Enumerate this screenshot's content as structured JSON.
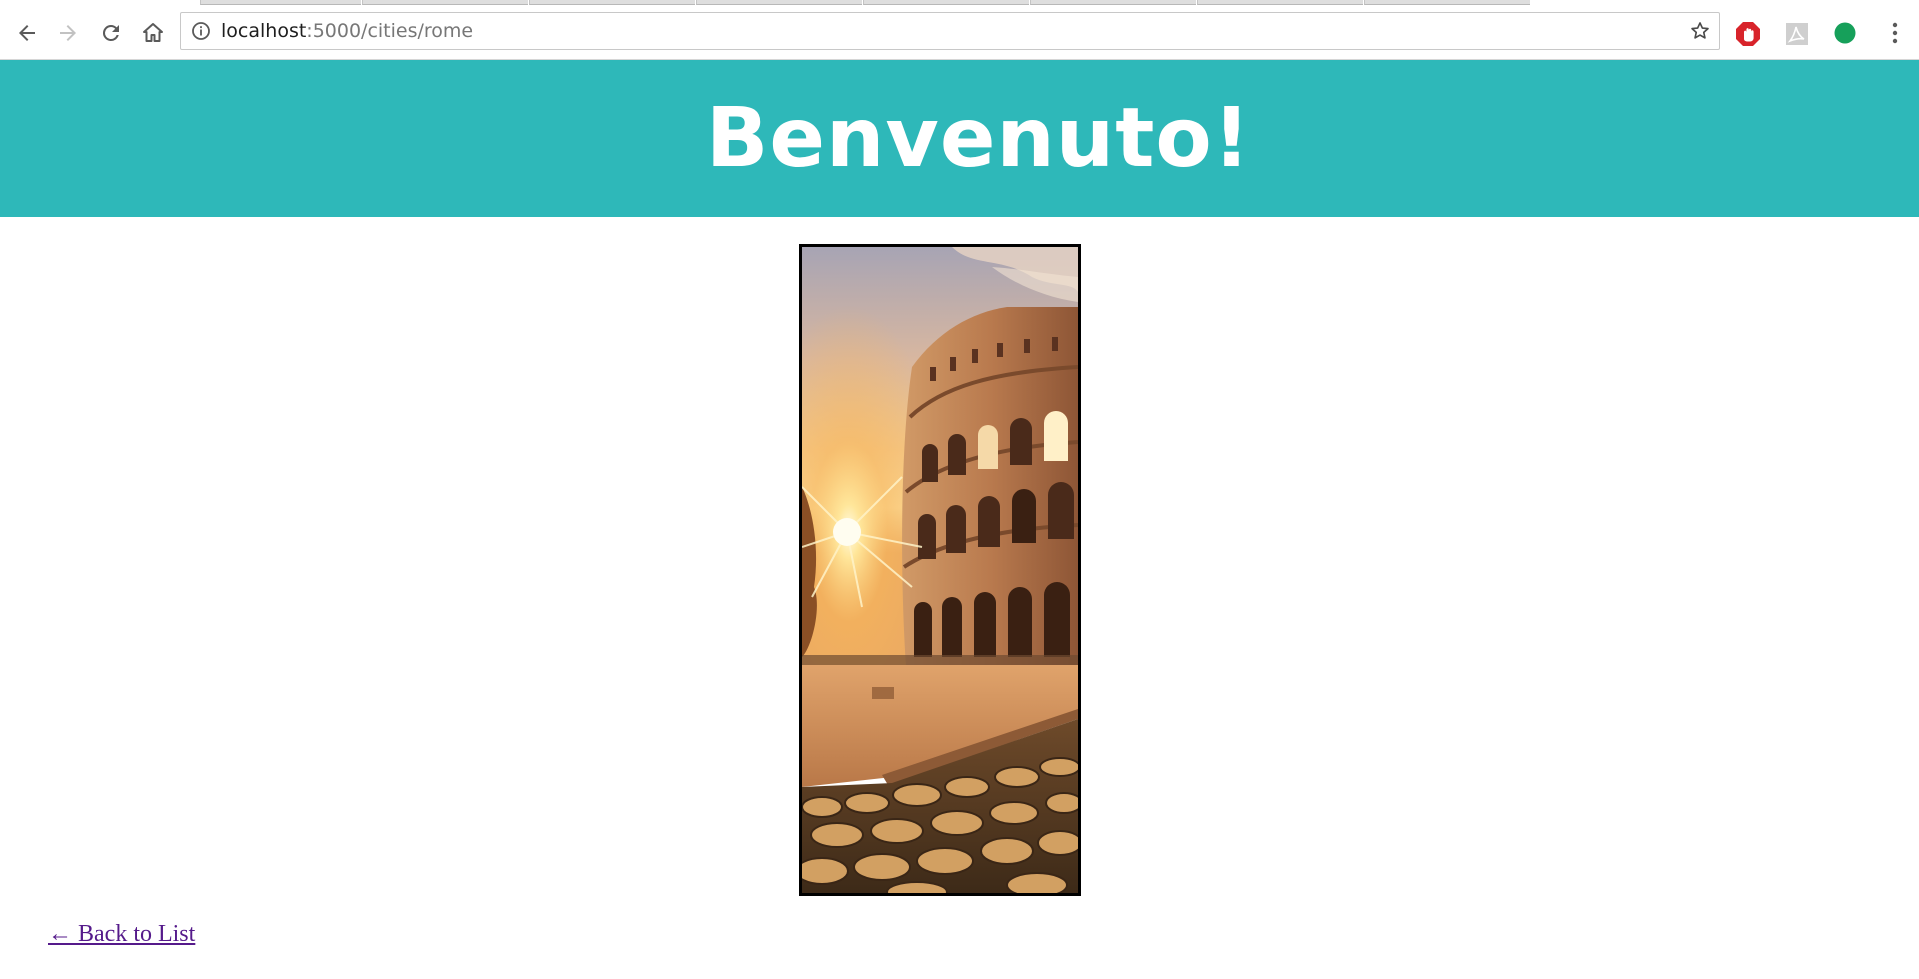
{
  "browser": {
    "url_host": "localhost",
    "url_path": ":5000/cities/rome",
    "toolbar_icons": [
      "back-arrow-icon",
      "forward-arrow-icon",
      "reload-icon",
      "home-icon",
      "info-icon",
      "bookmark-star-icon",
      "adblock-extension-icon",
      "pdf-extension-icon",
      "green-circle-extension-icon",
      "menu-dots-icon"
    ]
  },
  "page": {
    "heading": "Benvenuto!",
    "image_subject": "colosseum-photo",
    "back_link": "← Back to List"
  },
  "colors": {
    "header_background": "#2eb8b9",
    "header_text": "#ffffff",
    "link_visited": "#551a8b"
  }
}
